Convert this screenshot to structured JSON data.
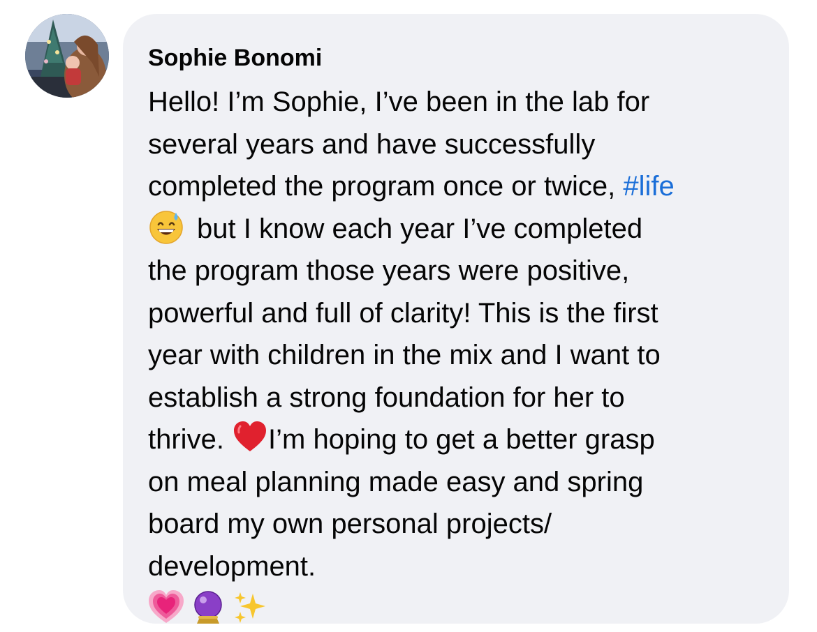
{
  "comment": {
    "author": "Sophie Bonomi",
    "lines": {
      "l1": "Hello! I’m Sophie, I’ve been in the lab for",
      "l2": "several years and have successfully",
      "l3_text": "completed the program once or twice, ",
      "l3_hashtag": "#life",
      "l4_text": "but I know each year I’ve completed",
      "l5": "the program those years were positive,",
      "l6": "powerful and full of clarity! This is the first",
      "l7": "year with children in the mix and I want to",
      "l8": "establish a strong foundation for her to",
      "l9_before": "thrive. ",
      "l9_after": "I’m hoping to get a better grasp",
      "l10": "on meal planning made easy and spring",
      "l11": "board my own personal projects/",
      "l12": "development."
    },
    "emojis": {
      "inline_1": "grinning-face-with-sweat-icon",
      "inline_2": "red-heart-icon",
      "trailing": [
        "growing-heart-icon",
        "crystal-ball-icon",
        "sparkles-icon"
      ]
    }
  },
  "colors": {
    "bubble_background": "#f0f1f5",
    "text": "#050505",
    "hashtag": "#1a6ed8"
  }
}
